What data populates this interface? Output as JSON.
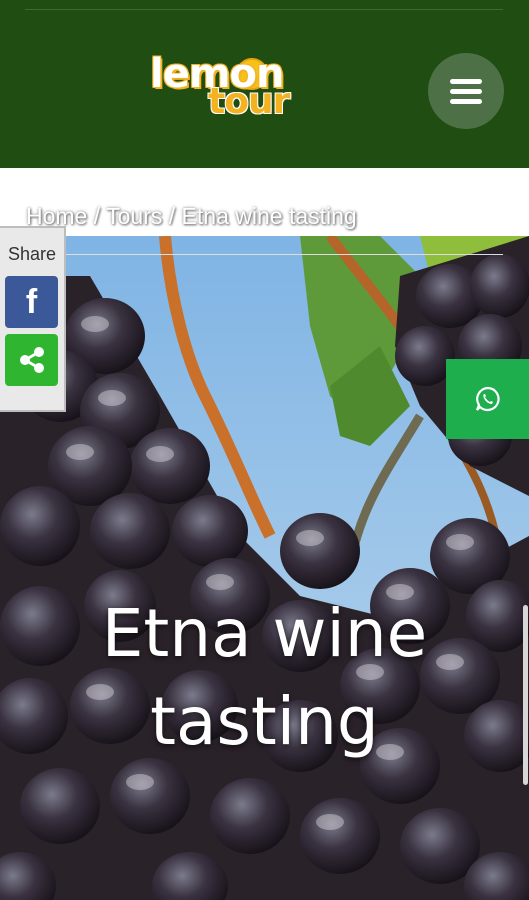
{
  "header": {
    "logo_line1": "lemon",
    "logo_line2": "tour",
    "menu_icon": "hamburger-menu-icon",
    "background_color": "#1f4d12"
  },
  "breadcrumb": {
    "home": "Home",
    "separator": "/",
    "tours": "Tours",
    "current": "Etna wine tasting"
  },
  "hero": {
    "title_line1": "Etna wine",
    "title_line2": "tasting"
  },
  "share": {
    "label": "Share",
    "facebook_icon": "facebook-icon",
    "share_icon": "share-icon",
    "facebook_color": "#3b5998",
    "share_color": "#2fb52f"
  },
  "whatsapp": {
    "icon": "whatsapp-icon",
    "color": "#1fae4e"
  }
}
